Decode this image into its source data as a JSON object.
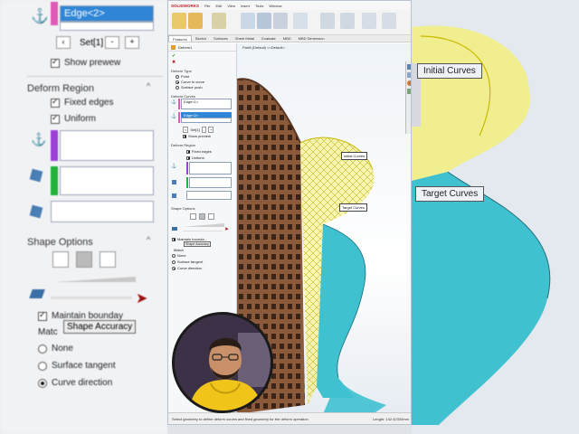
{
  "bg_left": {
    "edge_field": "Edge<2>",
    "set_label": "Set[1]",
    "show_preview": "Show prewew",
    "deform_region": "Deform Region",
    "fixed_edges": "Fixed edges",
    "uniform": "Uniform",
    "shape_options": "Shape Options",
    "maintain_boundary": "Maintain bounday",
    "shape_accuracy": "Shape Accuracy",
    "match": "Matc",
    "none": "None",
    "surface_tangent": "Surface tangent",
    "curve_direction": "Curve direction"
  },
  "bg_right": {
    "initial_curves": "Initial Curves",
    "target_curves": "Target Curves"
  },
  "app": {
    "brand": "SOLIDWORKS",
    "menus": [
      "File",
      "Edit",
      "View",
      "Insert",
      "Tools",
      "Window"
    ],
    "cmd_tabs": [
      "Features",
      "Sketch",
      "Surfaces",
      "Sheet Metal",
      "Evaluate",
      "MBD",
      "MBD Dimension"
    ],
    "active_tab": "Features",
    "tree_item": "Part8 (Default) <<Default>"
  },
  "pm": {
    "title": "Deform1",
    "deform_type": "Deform Type",
    "type_point": "Point",
    "type_curve_to_curve": "Curve to curve",
    "type_surface_push": "Surface push",
    "deform_curves": "Deform Curves",
    "initial_edge": "Edge<1>",
    "target_edge": "Edge<2>",
    "set_label": "Set[1]",
    "show_preview": "Show preview",
    "deform_region": "Deform Region",
    "fixed_edges": "Fixed edges",
    "uniform": "Uniform",
    "shape_options": "Shape Options",
    "maintain_boundary": "Maintain bounda...",
    "shape_accuracy": "Shape Accuracy",
    "match": "Match",
    "match_none": "None",
    "match_surface_tangent": "Surface tangent",
    "match_curve_direction": "Curve direction"
  },
  "viewport": {
    "initial_curves": "Initial Curves",
    "target_curves": "Target Curves"
  },
  "status": {
    "hint": "Select geometry to define deform curves and fixed geometry for the deform operation",
    "length": "Length: 142.42333mm"
  },
  "colors": {
    "wood": "#8a5a3a",
    "surface_teal": "#3fc1d0",
    "preview_yellow": "#f4ef6e",
    "selection_blue": "#2f86d6",
    "purple": "#9b3fd6",
    "green": "#22b33a"
  }
}
